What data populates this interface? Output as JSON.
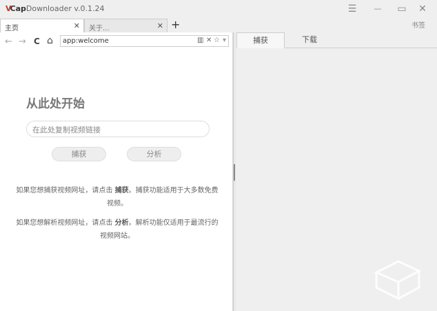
{
  "window": {
    "logo_v": "V",
    "logo_cap": "Cap",
    "app_name": "Downloader",
    "version": "v.0.1.24",
    "menu_icon": "☰",
    "minimize_icon": "—",
    "maximize_icon": "▭",
    "close_icon": "✕",
    "bookmarks": "书签"
  },
  "tabs": [
    {
      "label": "主页",
      "close": "✕"
    },
    {
      "label": "关于...",
      "close": "✕"
    }
  ],
  "new_tab": "+",
  "nav": {
    "back": "←",
    "forward": "→",
    "reload": "C",
    "home": "⌂",
    "address": "app:welcome",
    "reader_icon": "▥",
    "clear_icon": "✕",
    "star_icon": "☆",
    "dropdown_icon": "▾"
  },
  "welcome": {
    "heading": "从此处开始",
    "input_placeholder": "在此处复制视频链接",
    "capture_button": "捕获",
    "analyze_button": "分析",
    "para1_a": "如果您想捕获视频网址，请点击 ",
    "para1_b": "捕获",
    "para1_c": "。捕获功能适用于大多数免费视频。",
    "para2_a": "如果您想解析视频网址，请点击 ",
    "para2_b": "分析",
    "para2_c": "。解析功能仅适用于最流行的视频网站。"
  },
  "right_tabs": [
    {
      "label": "捕获",
      "active": true
    },
    {
      "label": "下载",
      "active": false
    }
  ]
}
